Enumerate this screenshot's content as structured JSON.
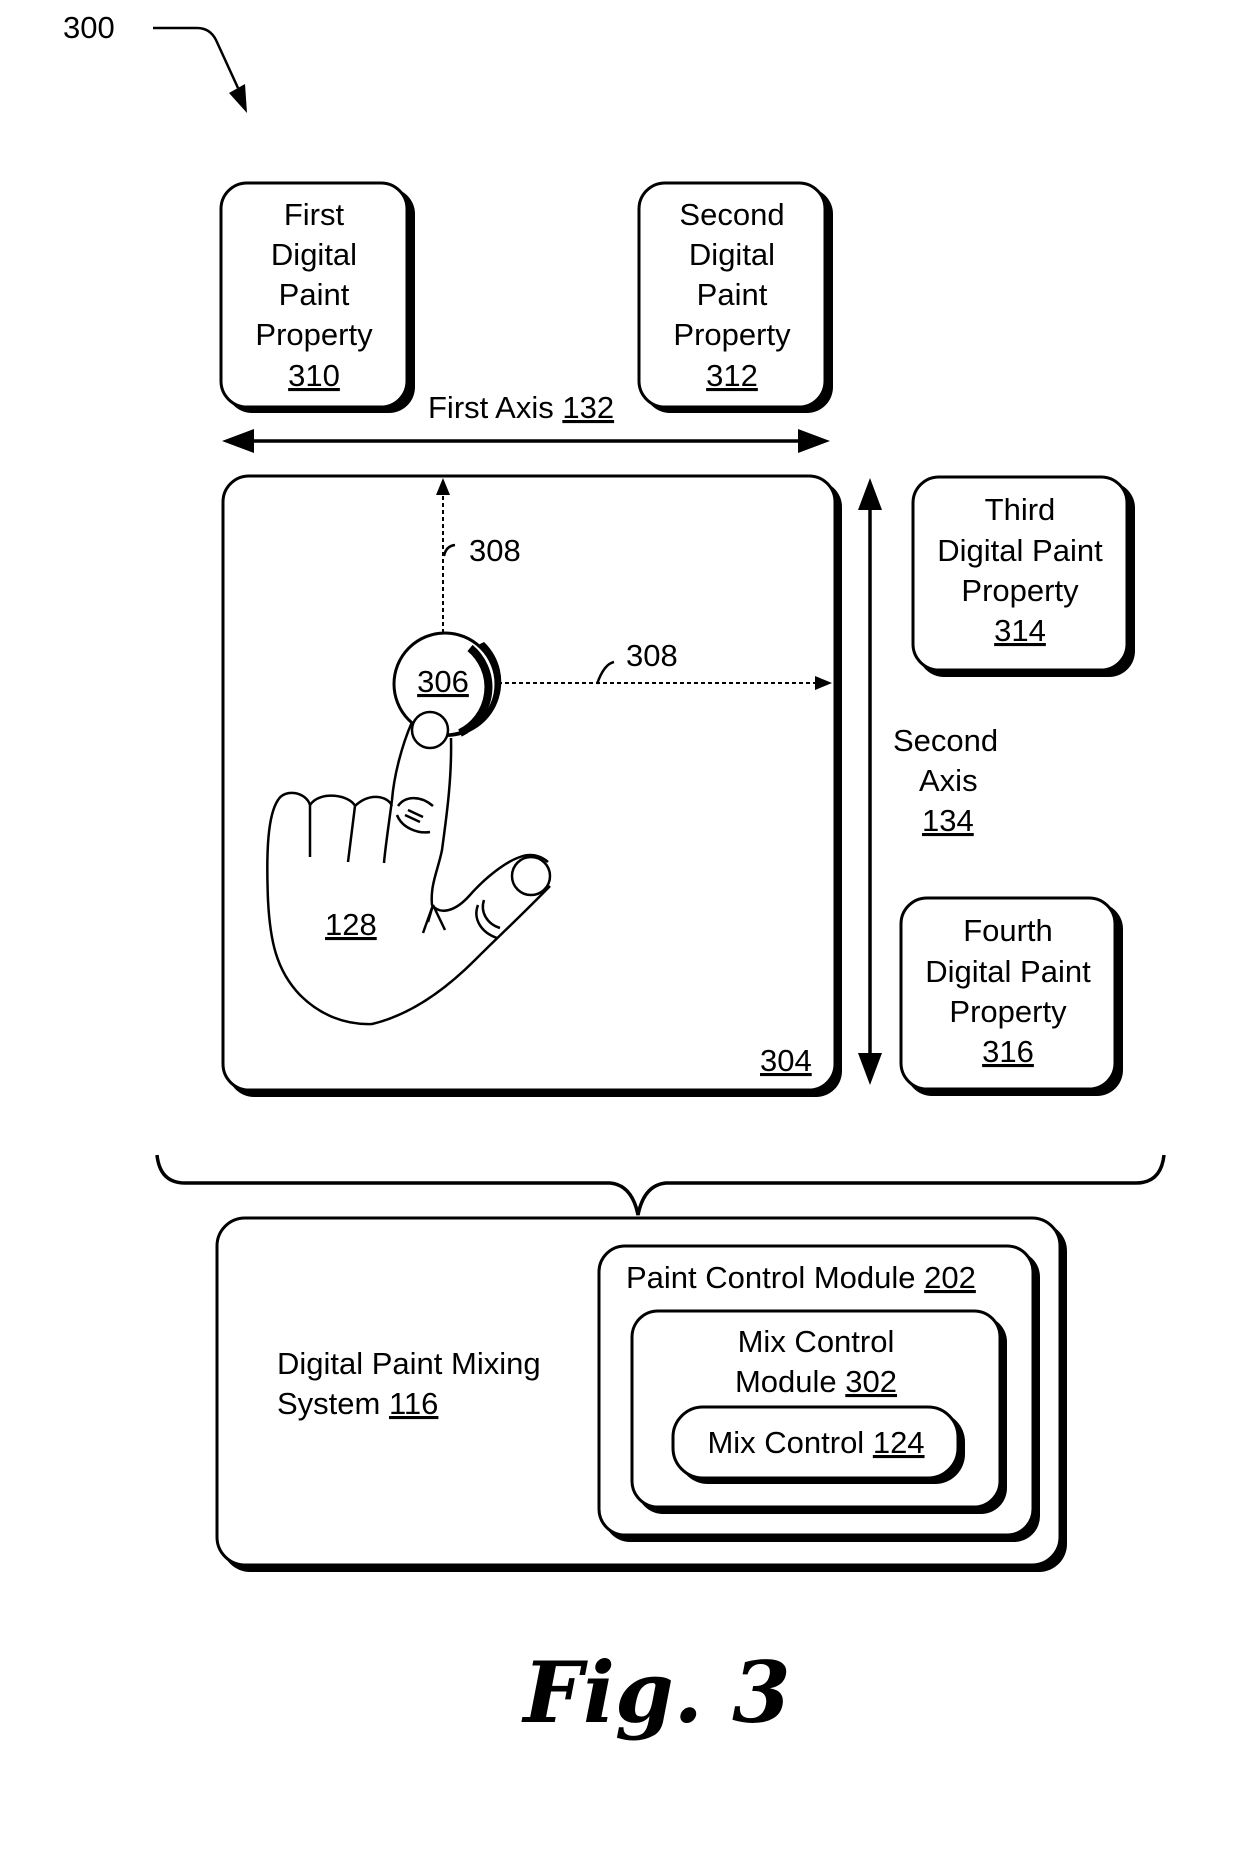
{
  "figure": {
    "ref_number": "300",
    "caption": "Fig. 3"
  },
  "properties": [
    {
      "id": "first",
      "lines": [
        "First",
        "Digital",
        "Paint",
        "Property"
      ],
      "ref": "310"
    },
    {
      "id": "second",
      "lines": [
        "Second",
        "Digital",
        "Paint",
        "Property"
      ],
      "ref": "312"
    },
    {
      "id": "third",
      "lines": [
        "Third",
        "Digital Paint",
        "Property"
      ],
      "ref": "314"
    },
    {
      "id": "fourth",
      "lines": [
        "Fourth",
        "Digital Paint",
        "Property"
      ],
      "ref": "316"
    }
  ],
  "axes": {
    "first": {
      "label": "First Axis",
      "ref": "132"
    },
    "second": {
      "lines": [
        "Second",
        "Axis"
      ],
      "ref": "134"
    }
  },
  "canvas": {
    "ref": "304",
    "hand_ref": "128",
    "touch_point_ref": "306",
    "movement_ref_vertical": "308",
    "movement_ref_horizontal": "308"
  },
  "system": {
    "label_lines": [
      "Digital Paint Mixing",
      "System"
    ],
    "ref": "116",
    "paint_control_module": {
      "label": "Paint Control Module",
      "ref": "202"
    },
    "mix_control_module": {
      "label_lines": [
        "Mix Control",
        "Module"
      ],
      "ref": "302"
    },
    "mix_control": {
      "label": "Mix Control",
      "ref": "124"
    }
  }
}
